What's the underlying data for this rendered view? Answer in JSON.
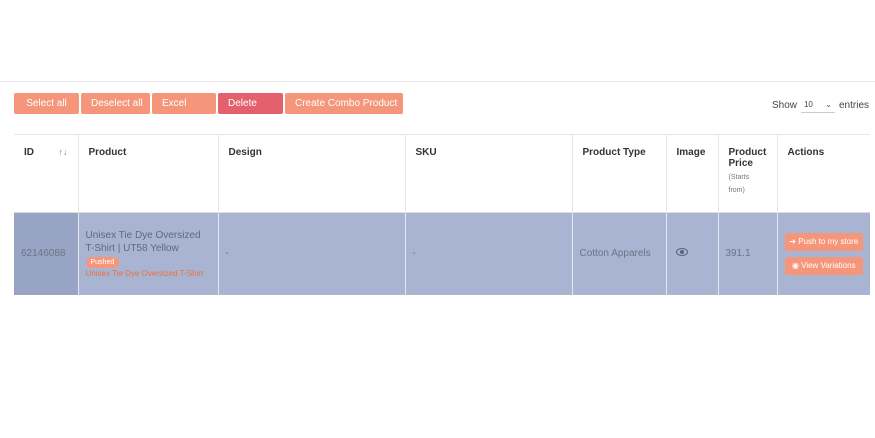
{
  "toolbar": {
    "select_all": "Select all",
    "deselect_all": "Deselect all",
    "excel": "Excel",
    "delete": "Delete",
    "combo": "Create Combo Product"
  },
  "entries": {
    "show_label": "Show",
    "value": "10",
    "suffix": "entries"
  },
  "table": {
    "headers": {
      "id": "ID",
      "id_sort_icon": "↑↓",
      "product": "Product",
      "design": "Design",
      "sku": "SKU",
      "product_type": "Product Type",
      "image": "Image",
      "product_price": "Product Price",
      "price_sub": "(Starts from)",
      "actions": "Actions"
    },
    "rows": [
      {
        "id": "62146088",
        "product": "Unisex Tie Dye Oversized T-Shirt | UT58 Yellow",
        "badge": "Pushed",
        "product_sub": "Unisex Tie Dye Oversized T-Shirt",
        "design": "-",
        "sku": "-",
        "product_type": "Cotton Apparels",
        "image_icon": "eye-icon",
        "price": "391.1",
        "action_push": "Push to my store",
        "action_view": "View Variations"
      }
    ]
  },
  "colors": {
    "accent": "#f5967a",
    "danger": "#e4606d",
    "row_highlight": "#a8b4d1"
  }
}
